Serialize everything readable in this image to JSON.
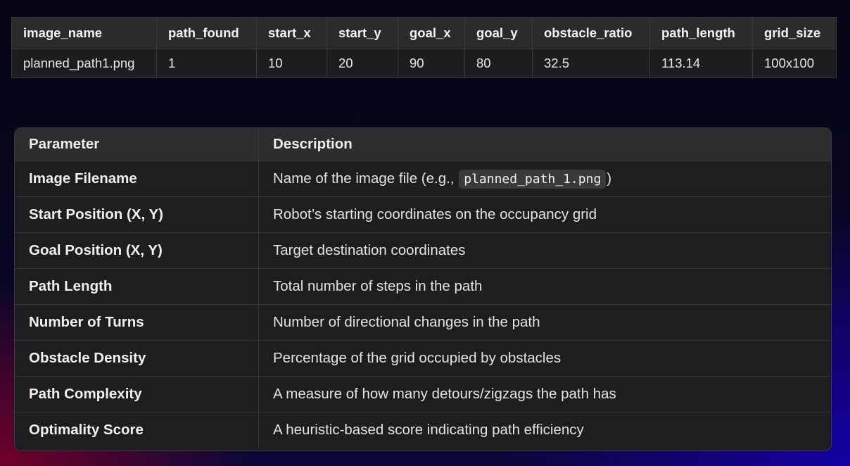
{
  "summary_table": {
    "headers": [
      "image_name",
      "path_found",
      "start_x",
      "start_y",
      "goal_x",
      "goal_y",
      "obstacle_ratio",
      "path_length",
      "grid_size"
    ],
    "rows": [
      [
        "planned_path1.png",
        "1",
        "10",
        "20",
        "90",
        "80",
        "32.5",
        "113.14",
        "100x100"
      ]
    ]
  },
  "parameter_table": {
    "headers": [
      "Parameter",
      "Description"
    ],
    "rows": [
      {
        "parameter": "Image Filename",
        "description_before": "Name of the image file (e.g., ",
        "description_code": "planned_path_1.png",
        "description_after": ")"
      },
      {
        "parameter": "Start Position (X, Y)",
        "description": "Robot’s starting coordinates on the occupancy grid"
      },
      {
        "parameter": "Goal Position (X, Y)",
        "description": "Target destination coordinates"
      },
      {
        "parameter": "Path Length",
        "description": "Total number of steps in the path"
      },
      {
        "parameter": "Number of Turns",
        "description": "Number of directional changes in the path"
      },
      {
        "parameter": "Obstacle Density",
        "description": "Percentage of the grid occupied by obstacles"
      },
      {
        "parameter": "Path Complexity",
        "description": "A measure of how many detours/zigzags the path has"
      },
      {
        "parameter": "Optimality Score",
        "description": "A heuristic-based score indicating path efficiency"
      }
    ]
  }
}
